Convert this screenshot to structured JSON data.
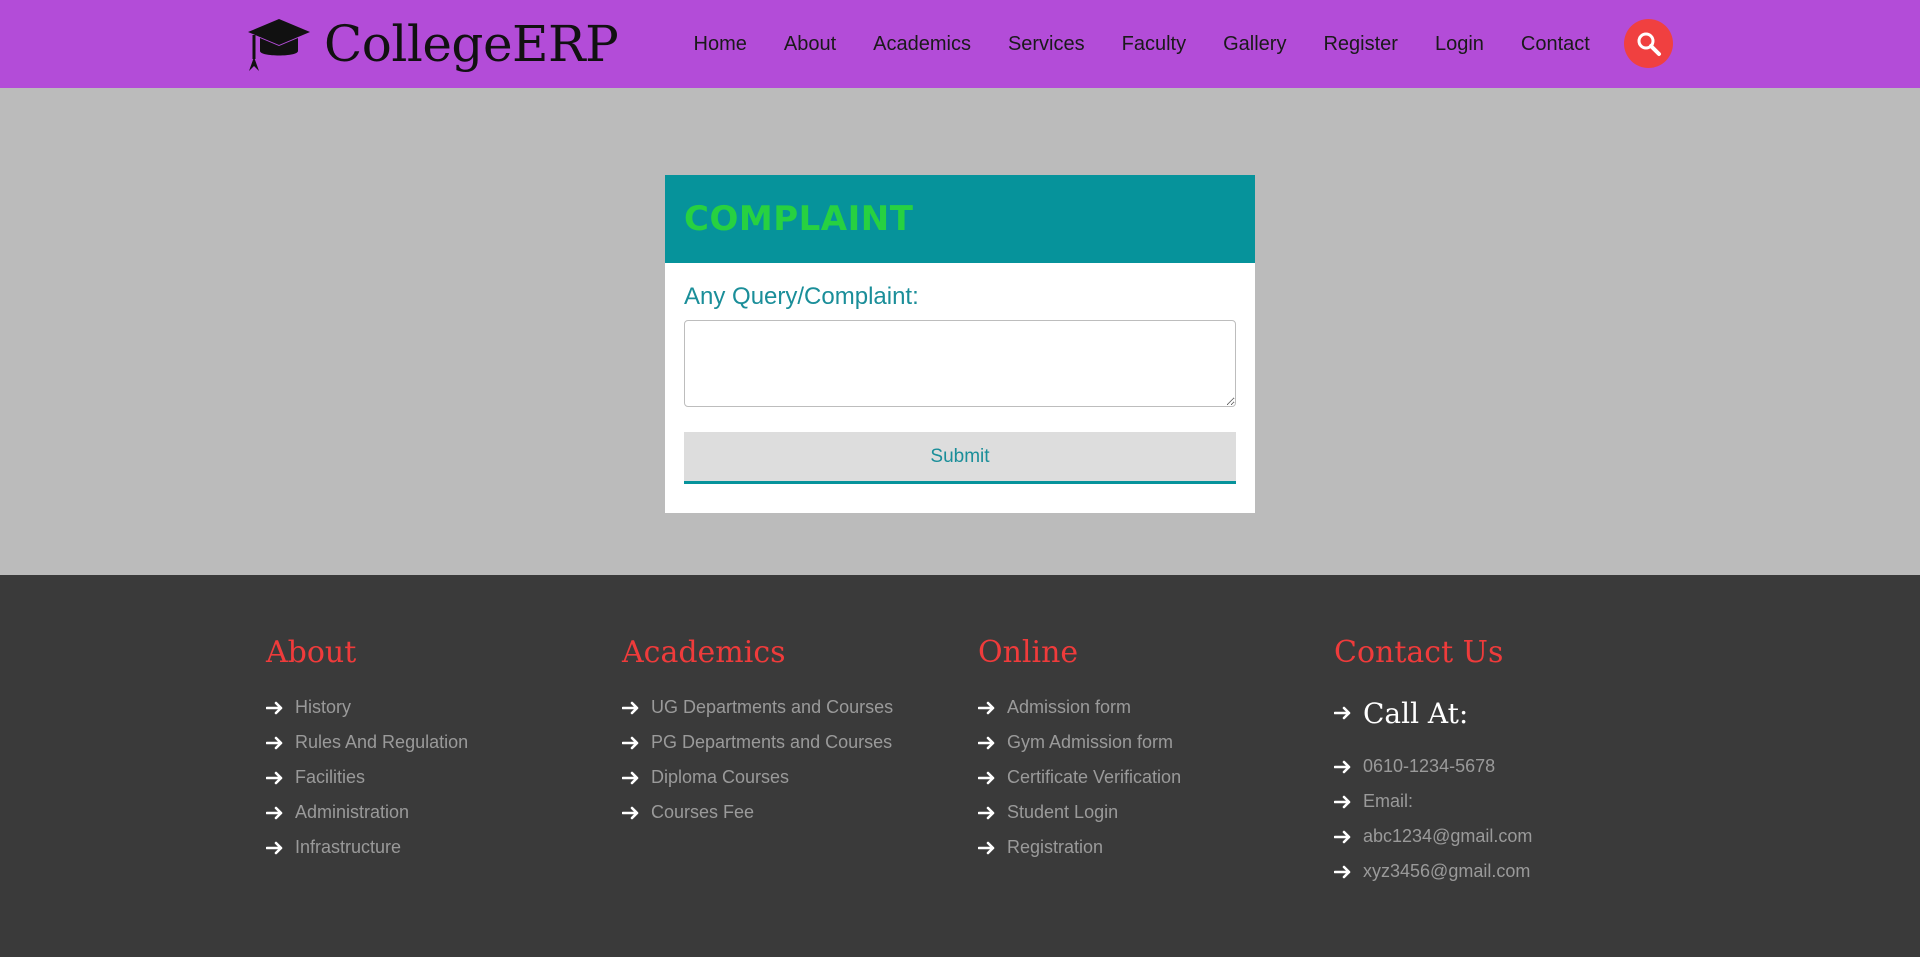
{
  "brand": {
    "name": "CollegeERP",
    "icon": "graduation-cap-icon"
  },
  "nav": {
    "items": [
      "Home",
      "About",
      "Academics",
      "Services",
      "Faculty",
      "Gallery",
      "Register",
      "Login",
      "Contact"
    ],
    "search_icon": "search-icon"
  },
  "complaint": {
    "title": "COMPLAINT",
    "label": "Any Query/Complaint:",
    "textarea_value": "",
    "submit_label": "Submit"
  },
  "footer": {
    "about": {
      "title": "About",
      "links": [
        "History",
        "Rules And Regulation",
        "Facilities",
        "Administration",
        "Infrastructure"
      ]
    },
    "academics": {
      "title": "Academics",
      "links": [
        "UG Departments and Courses",
        "PG Departments and Courses",
        "Diploma Courses",
        "Courses Fee"
      ]
    },
    "online": {
      "title": "Online",
      "links": [
        "Admission form",
        "Gym Admission form",
        "Certificate Verification",
        "Student Login",
        "Registration"
      ]
    },
    "contact": {
      "title": "Contact Us",
      "call_at": "Call At:",
      "phone": "0610-1234-5678",
      "email_label": "Email:",
      "emails": [
        "abc1234@gmail.com",
        "xyz3456@gmail.com"
      ]
    }
  },
  "colors": {
    "header_bg": "#b34cd8",
    "card_header_bg": "#06939b",
    "title_green": "#27d141",
    "footer_bg": "#3a3a3a",
    "footer_heading": "#ef3b3b",
    "search_bg": "#f04040"
  }
}
